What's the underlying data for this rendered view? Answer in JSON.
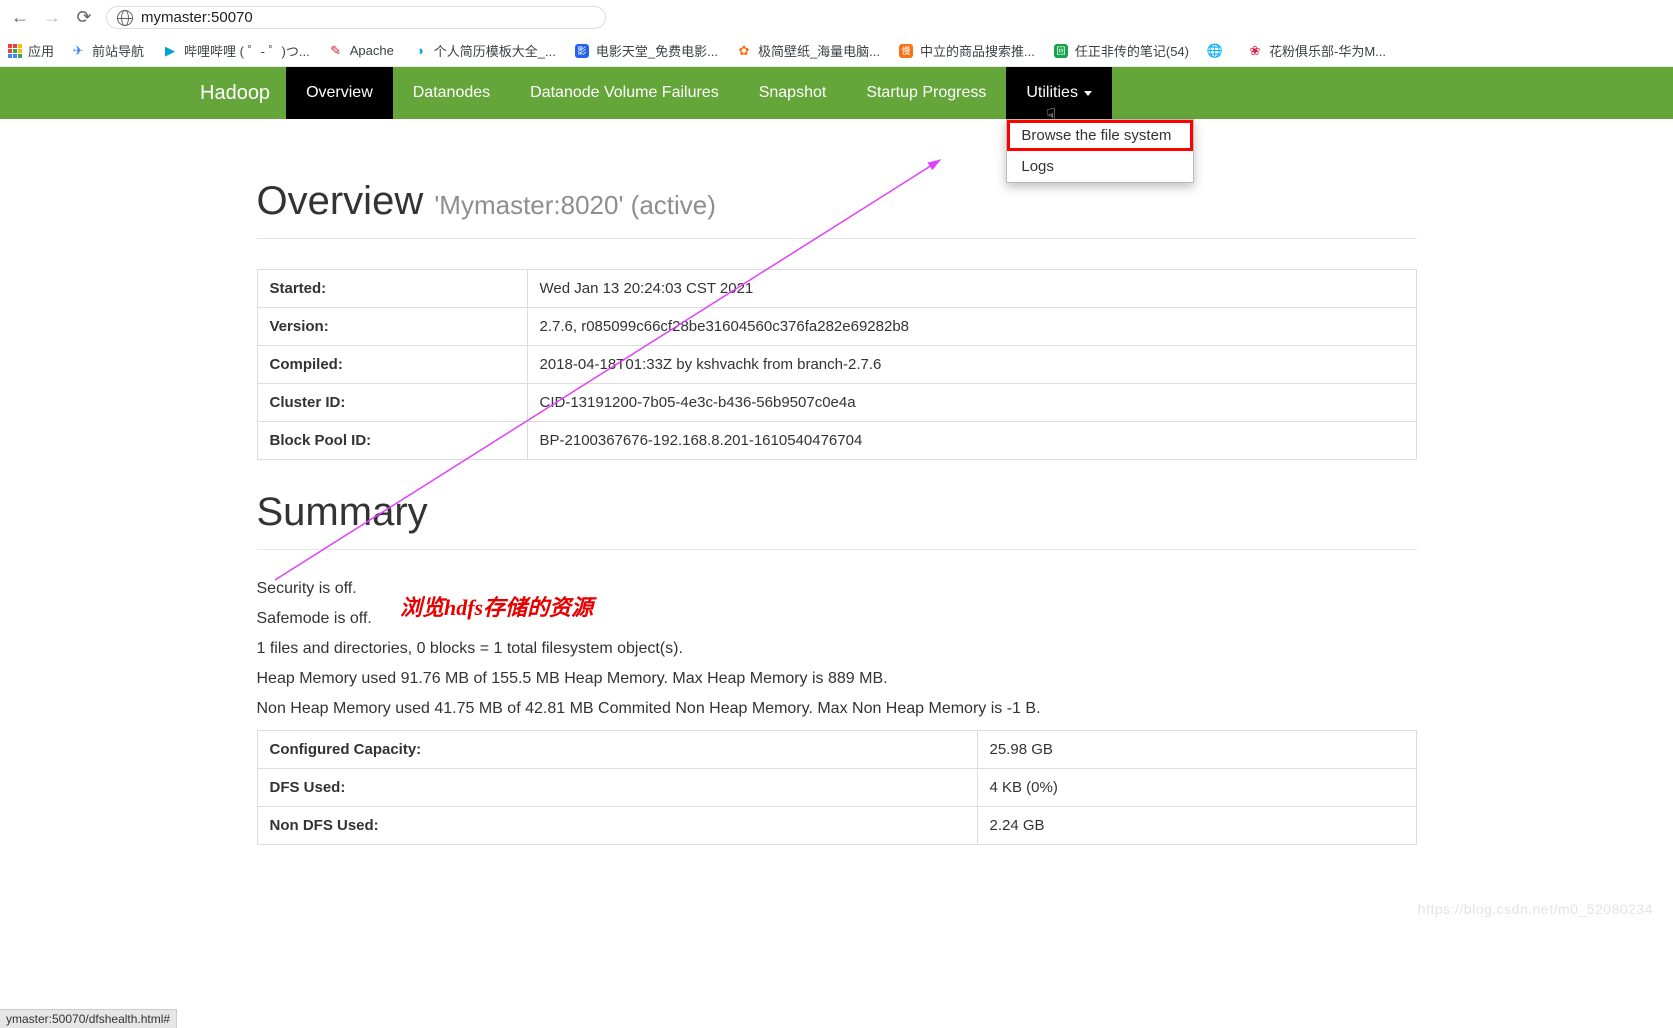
{
  "browser": {
    "url": "mymaster:50070",
    "status_bar": "ymaster:50070/dfshealth.html#"
  },
  "bookmarks": {
    "apps": "应用",
    "items": [
      {
        "label": "前站导航",
        "color": "#3b82f6",
        "glyph": "✈"
      },
      {
        "label": "哔哩哔哩 ( ゜- ゜)つ...",
        "color": "#00a1d6",
        "glyph": "▶"
      },
      {
        "label": "Apache",
        "color": "#d22128",
        "glyph": "✎"
      },
      {
        "label": "个人简历模板大全_...",
        "color": "#0ea5e9",
        "glyph": "◑"
      },
      {
        "label": "电影天堂_免费电影...",
        "color": "#2563eb",
        "glyph": "影"
      },
      {
        "label": "极简壁纸_海量电脑...",
        "color": "#f97316",
        "glyph": "✿"
      },
      {
        "label": "中立的商品搜索推...",
        "color": "#f97316",
        "glyph": "慢"
      },
      {
        "label": "任正非传的笔记(54)",
        "color": "#16a34a",
        "glyph": "回"
      },
      {
        "label": "",
        "color": "#6b7280",
        "glyph": "🌐"
      },
      {
        "label": "花粉俱乐部-华为M...",
        "color": "#e11d48",
        "glyph": "❀"
      }
    ]
  },
  "navbar": {
    "brand": "Hadoop",
    "items": [
      {
        "label": "Overview",
        "active": true
      },
      {
        "label": "Datanodes"
      },
      {
        "label": "Datanode Volume Failures"
      },
      {
        "label": "Snapshot"
      },
      {
        "label": "Startup Progress"
      },
      {
        "label": "Utilities",
        "dropdown": true
      }
    ],
    "dropdown": [
      {
        "label": "Browse the file system",
        "highlighted": true
      },
      {
        "label": "Logs"
      }
    ]
  },
  "overview": {
    "heading": "Overview",
    "subheading": "'Mymaster:8020' (active)",
    "rows": [
      {
        "k": "Started:",
        "v": "Wed Jan 13 20:24:03 CST 2021"
      },
      {
        "k": "Version:",
        "v": "2.7.6, r085099c66cf28be31604560c376fa282e69282b8"
      },
      {
        "k": "Compiled:",
        "v": "2018-04-18T01:33Z by kshvachk from branch-2.7.6"
      },
      {
        "k": "Cluster ID:",
        "v": "CID-13191200-7b05-4e3c-b436-56b9507c0e4a"
      },
      {
        "k": "Block Pool ID:",
        "v": "BP-2100367676-192.168.8.201-1610540476704"
      }
    ]
  },
  "summary": {
    "heading": "Summary",
    "lines": [
      "Security is off.",
      "Safemode is off.",
      "1 files and directories, 0 blocks = 1 total filesystem object(s).",
      "Heap Memory used 91.76 MB of 155.5 MB Heap Memory. Max Heap Memory is 889 MB.",
      "Non Heap Memory used 41.75 MB of 42.81 MB Commited Non Heap Memory. Max Non Heap Memory is -1 B."
    ],
    "table": [
      {
        "k": "Configured Capacity:",
        "v": "25.98 GB"
      },
      {
        "k": "DFS Used:",
        "v": "4 KB (0%)"
      },
      {
        "k": "Non DFS Used:",
        "v": "2.24 GB"
      }
    ]
  },
  "annotation": "浏览hdfs存储的资源",
  "watermark": "https://blog.csdn.net/m0_52080234"
}
